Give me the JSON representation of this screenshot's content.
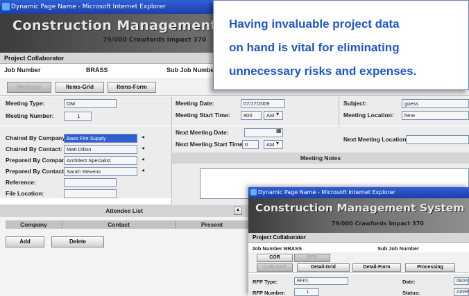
{
  "window": {
    "title": "Dynamic Page Name - Microsoft Internet Explorer"
  },
  "app": {
    "name": "Construction Management System",
    "project": "79/000  Crawfords Impact 370"
  },
  "collab": "Project Collaborator",
  "job": {
    "number_label": "Job Number",
    "number_value": "BRASS",
    "sub_label": "Sub Job Number"
  },
  "tabs": {
    "meetings": "Meetings",
    "items_grid": "Items-Grid",
    "items_form": "Items-Form"
  },
  "meeting": {
    "type_label": "Meeting Type:",
    "type_value": "OM",
    "number_label": "Meeting Number:",
    "number_value": "1",
    "date_label": "Meeting Date:",
    "date_value": "07/17/2009",
    "start_label": "Meeting Start Time:",
    "start_value": "800",
    "start_ampm": "AM",
    "subject_label": "Subject:",
    "subject_value": "guess",
    "location_label": "Meeting Location:",
    "location_value": "here",
    "next_date_label": "Next Meeting Date:",
    "next_start_label": "Next Meeting Start Time:",
    "next_start_value": "0",
    "next_ampm": "AM",
    "next_location_label": "Next Meeting Location:",
    "notes_label": "Meeting Notes"
  },
  "chair": {
    "company_label": "Chaired By Company:",
    "company_value": "Bass Fire Supply",
    "contact_label": "Chaired By Contact:",
    "contact_value": "Matt Dillon",
    "prep_company_label": "Prepared By Company:",
    "prep_company_value": "Architect Specialist",
    "prep_contact_label": "Prepared By Contact:",
    "prep_contact_value": "Sarah Stevens",
    "reference_label": "Reference:",
    "file_label": "File Location:"
  },
  "attendees": {
    "title": "Attendee List",
    "columns": [
      "Company",
      "Contact",
      "Present"
    ],
    "add": "Add",
    "delete": "Delete"
  },
  "callout": {
    "line1": "Having invaluable project data",
    "line2": "on hand is vital for eliminating",
    "line3": "unnecessary risks and expenses."
  },
  "win2": {
    "title": "Dynamic Page Name - Microsoft Internet Explorer",
    "collab": "Project Collaborator",
    "job": "Job Number  BRASS",
    "sub": "Sub Job Number",
    "btn_cor": "COR",
    "btn_rfp": "RFP",
    "btn_cor_grid": "COR-Grid",
    "btn_detail_grid": "Detail-Grid",
    "btn_detail_form": "Detail-Form",
    "btn_processing": "Processing",
    "rfp_type_label": "RFP Type:",
    "rfp_type_value": "RFP1",
    "rfp_number_label": "RFP Number:",
    "rfp_number_value": "1",
    "date_label": "Date:",
    "date_value": "09/24",
    "status_label": "Status:",
    "status_value": "APPR"
  },
  "colors": {
    "callout_text": "#1f56c9",
    "selected_field": "#2f5fd0"
  }
}
